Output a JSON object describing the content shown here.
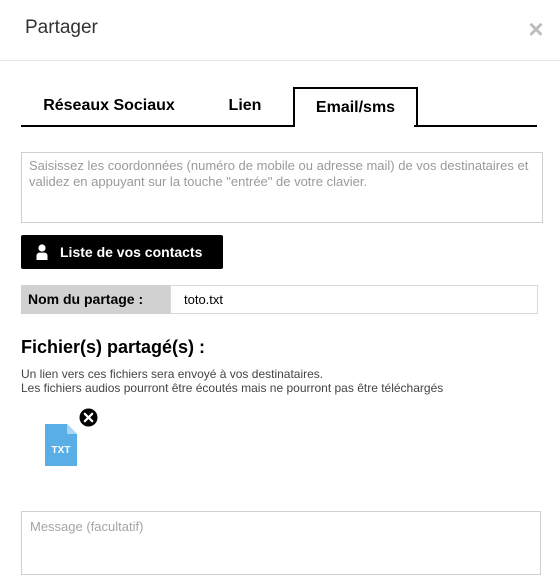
{
  "dialog": {
    "title": "Partager",
    "close_glyph": "×"
  },
  "tabs": [
    {
      "label": "Réseaux Sociaux",
      "active": false
    },
    {
      "label": "Lien",
      "active": false
    },
    {
      "label": "Email/sms",
      "active": true
    }
  ],
  "recipients": {
    "placeholder": "Saisissez les coordonnées (numéro de mobile ou adresse mail) de vos destinataires et validez en appuyant sur la touche \"entrée\" de votre clavier.",
    "value": ""
  },
  "contacts_button": {
    "label": "Liste de vos contacts",
    "icon": "person-icon"
  },
  "share_name": {
    "label": "Nom du partage :",
    "value": "toto.txt"
  },
  "files": {
    "heading": "Fichier(s) partagé(s) :",
    "desc_line1": "Un lien vers ces fichiers sera envoyé à vos destinataires.",
    "desc_line2": "Les fichiers audios pourront être écoutés mais ne pourront pas être téléchargés",
    "items": [
      {
        "ext": "TXT",
        "icon": "txt-file-icon",
        "color": "#5aaee6"
      }
    ]
  },
  "message": {
    "placeholder": "Message (facultatif)",
    "value": ""
  },
  "colors": {
    "accent": "#000000",
    "label_bg": "#d1d1d1",
    "file_blue": "#5aaee6"
  }
}
